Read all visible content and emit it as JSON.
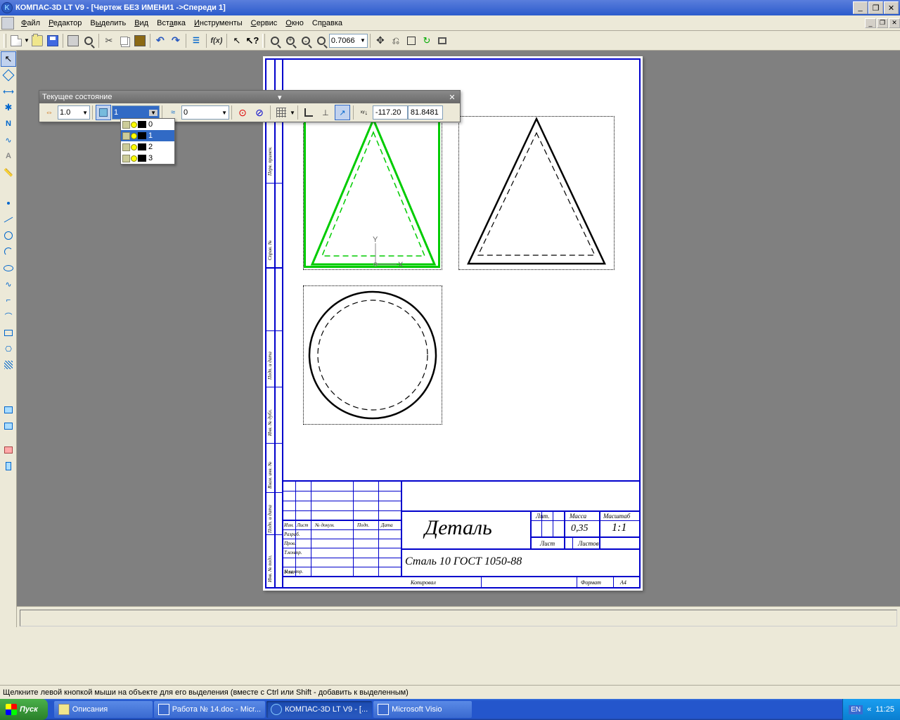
{
  "titlebar": {
    "title": "КОМПАС-3D LT V9 - [Чертеж БЕЗ ИМЕНИ1 ->Спереди 1]",
    "app_icon": "K"
  },
  "menu": {
    "file": "Файл",
    "edit": "Редактор",
    "select": "Выделить",
    "view": "Вид",
    "insert": "Вставка",
    "tools": "Инструменты",
    "service": "Сервис",
    "window": "Окно",
    "help": "Справка"
  },
  "toolbar2": {
    "zoom_value": "0.7066",
    "coord_x": "-117.20",
    "coord_y": "81.8481"
  },
  "floating": {
    "title": "Текущее состояние",
    "step": "1.0",
    "layer": "1",
    "color_idx": "0"
  },
  "layers": {
    "list": [
      {
        "num": "0"
      },
      {
        "num": "1"
      },
      {
        "num": "2"
      },
      {
        "num": "3"
      }
    ]
  },
  "titleblock": {
    "part_name": "Деталь",
    "material": "Сталь 10  ГОСТ 1050-88",
    "lit": "Лит.",
    "mass": "Масса",
    "scale": "Масштаб",
    "mass_val": "0,35",
    "scale_val": "1:1",
    "list": "Лист",
    "listov": "Листов",
    "izm": "Изм.",
    "list2": "Лист",
    "ndokum": "№ докум.",
    "podp": "Подп.",
    "data": "Дата",
    "razrab": "Разраб.",
    "prov": "Пров.",
    "tkontr": "Т.контр.",
    "nkontr": "Н.контр.",
    "utv": "Утв.",
    "kopirovaal": "Копировал",
    "format": "Формат",
    "a4": "А4",
    "spravn": "Справ. №",
    "perv": "Перв. примен.",
    "inv_podl": "Инв. № подл.",
    "podp_data": "Подп. и дата",
    "vzam_inv": "Взам. инв. №",
    "inv_dubl": "Инв. № дубл.",
    "podp_data2": "Подп. и дата"
  },
  "origin": {
    "x_label": "X",
    "y_label": "Y"
  },
  "statusbar": {
    "hint": "Щелкните левой кнопкой мыши на объекте для его выделения (вместе с Ctrl или Shift - добавить к выделенным)"
  },
  "taskbar": {
    "start": "Пуск",
    "items": [
      {
        "label": "Описания"
      },
      {
        "label": "Работа № 14.doc - Micr..."
      },
      {
        "label": "КОМПАС-3D LT V9 - [..."
      },
      {
        "label": "Microsoft Visio"
      }
    ],
    "lang": "EN",
    "chev": "«",
    "time": "11:25"
  }
}
